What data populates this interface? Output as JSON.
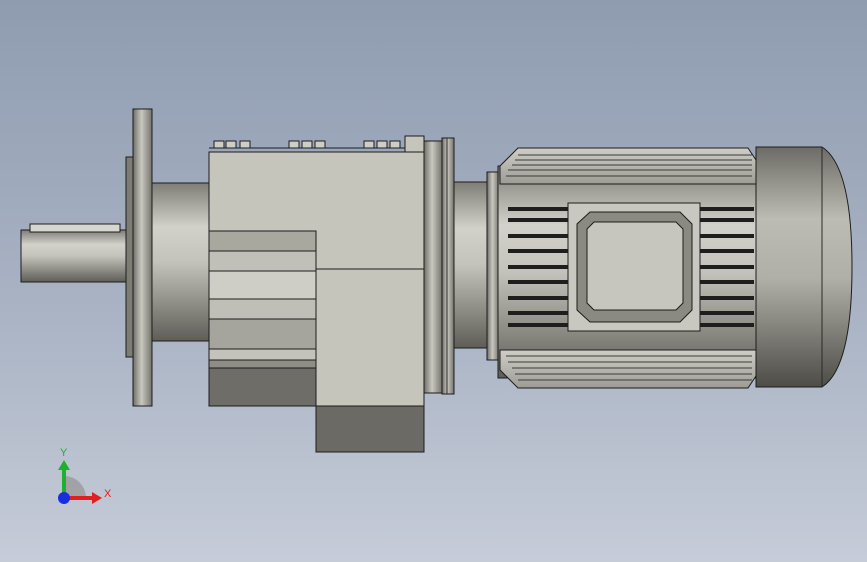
{
  "viewport": {
    "model_name": "gear-motor-assembly",
    "view": "front"
  },
  "triad": {
    "x_label": "X",
    "y_label": "Y",
    "x_color": "#e02020",
    "y_color": "#20b030",
    "z_color": "#1a2ee0"
  },
  "colors": {
    "bg_top": "#8f9cb0",
    "bg_bottom": "#c6ccd8",
    "body": "#c6c5bc",
    "edge": "#1c1c1c"
  }
}
